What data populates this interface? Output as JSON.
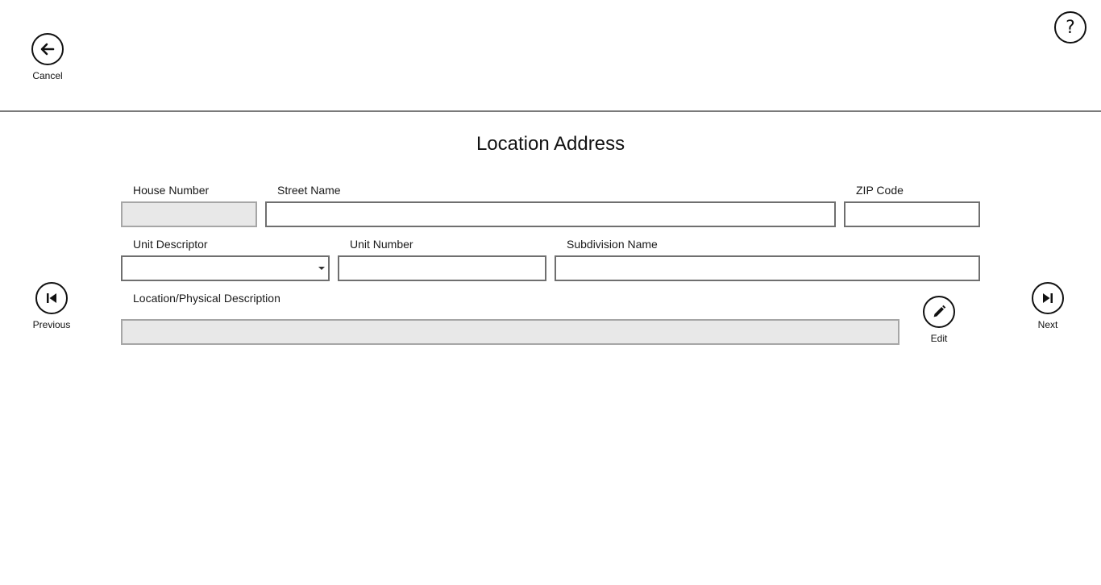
{
  "header": {
    "cancel_label": "Cancel"
  },
  "main": {
    "title": "Location Address",
    "fields": {
      "house_number": {
        "label": "House Number",
        "value": ""
      },
      "street_name": {
        "label": "Street Name",
        "value": ""
      },
      "zip_code": {
        "label": "ZIP Code",
        "value": ""
      },
      "unit_descriptor": {
        "label": "Unit Descriptor",
        "value": ""
      },
      "unit_number": {
        "label": "Unit Number",
        "value": ""
      },
      "subdivision_name": {
        "label": "Subdivision Name",
        "value": ""
      },
      "location_description": {
        "label": "Location/Physical Description",
        "value": ""
      }
    },
    "edit_label": "Edit"
  },
  "nav": {
    "previous_label": "Previous",
    "next_label": "Next"
  },
  "icons": {
    "cancel": "arrow-left-icon",
    "help": "question-mark-icon",
    "previous": "skip-previous-icon",
    "next": "skip-next-icon",
    "edit": "pencil-icon"
  }
}
